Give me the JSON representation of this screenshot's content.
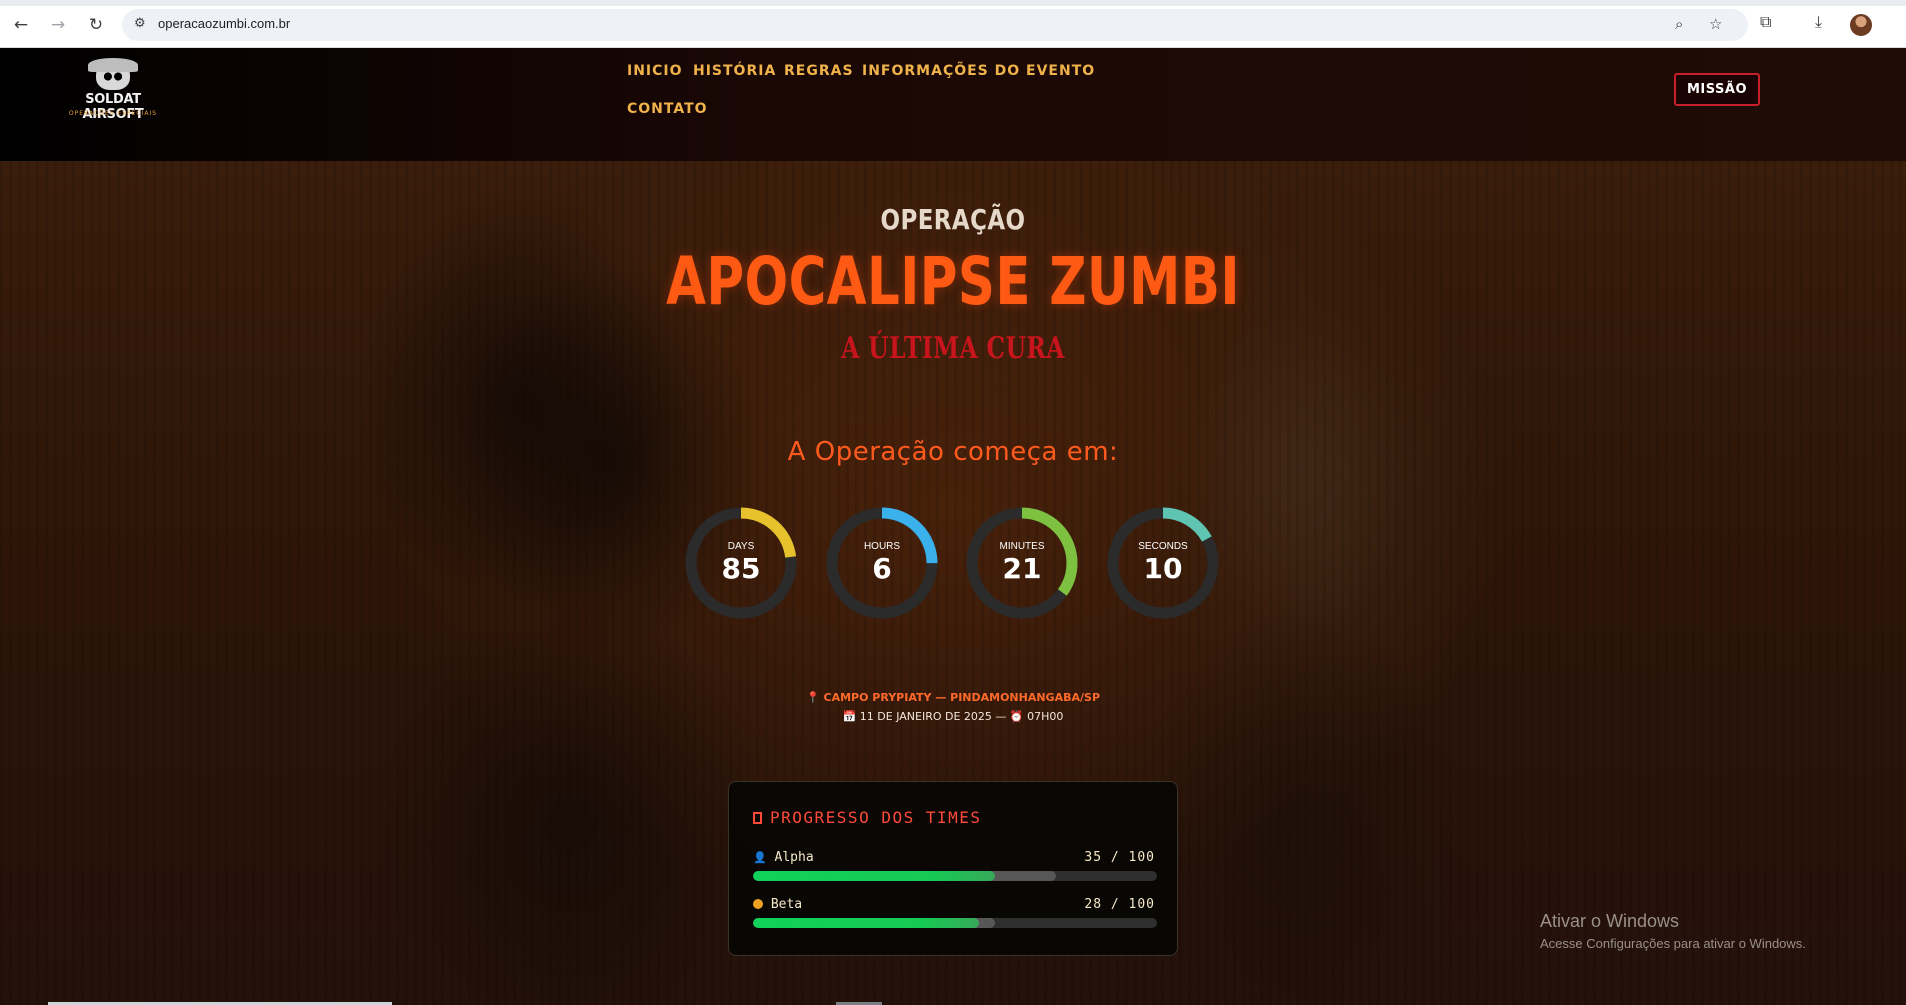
{
  "browser": {
    "url": "operacaozumbi.com.br",
    "back_icon": "arrow-left-icon",
    "forward_icon": "arrow-right-icon",
    "reload_icon": "reload-icon",
    "site_info_icon": "tune-icon",
    "zoom_icon": "zoom-icon",
    "bookmark_icon": "star-icon",
    "extensions_icon": "puzzle-icon",
    "download_icon": "download-icon"
  },
  "header": {
    "logo": {
      "name": "SOLDAT AIRSOFT",
      "tagline": "OPERAÇÕES ESPECIAIS"
    },
    "menu": [
      "INICIO",
      "HISTÓRIA",
      "REGRAS",
      "INFORMAÇÕES DO EVENTO",
      "CONTATO"
    ],
    "cta_label": "MISSÃO"
  },
  "hero": {
    "pretitle": "OPERAÇÃO",
    "title": "APOCALIPSE ZUMBI",
    "subtitle": "A ÚLTIMA CURA",
    "countdown_heading": "A Operação começa em:",
    "countdown": [
      {
        "label": "DAYS",
        "value": "85",
        "fraction": 0.23,
        "color": "#e8c22c"
      },
      {
        "label": "HOURS",
        "value": "6",
        "fraction": 0.25,
        "color": "#3ab1ea"
      },
      {
        "label": "MINUTES",
        "value": "21",
        "fraction": 0.35,
        "color": "#7ec040"
      },
      {
        "label": "SECONDS",
        "value": "10",
        "fraction": 0.17,
        "color": "#5fc4b2"
      }
    ],
    "location": "CAMPO PRYPIATY — PINDAMONHANGABA/SP",
    "location_icon": "pin-icon",
    "date_text": "11 DE JANEIRO DE 2025 —",
    "calendar_icon": "calendar-icon",
    "time_text": "07H00",
    "clock_icon": "alarm-clock-icon"
  },
  "progress_panel": {
    "title": "PROGRESSO DOS TIMES",
    "teams": [
      {
        "icon": "person-icon",
        "name": "Alpha",
        "score_text": "35 / 100",
        "fill": 0.6,
        "track": 0.75
      },
      {
        "icon": "orange-circle-icon",
        "name": "Beta",
        "score_text": "28 / 100",
        "fill": 0.56,
        "track": 0.6
      }
    ]
  },
  "windows_watermark": {
    "line1": "Ativar o Windows",
    "line2": "Acesse Configurações para ativar o Windows."
  }
}
